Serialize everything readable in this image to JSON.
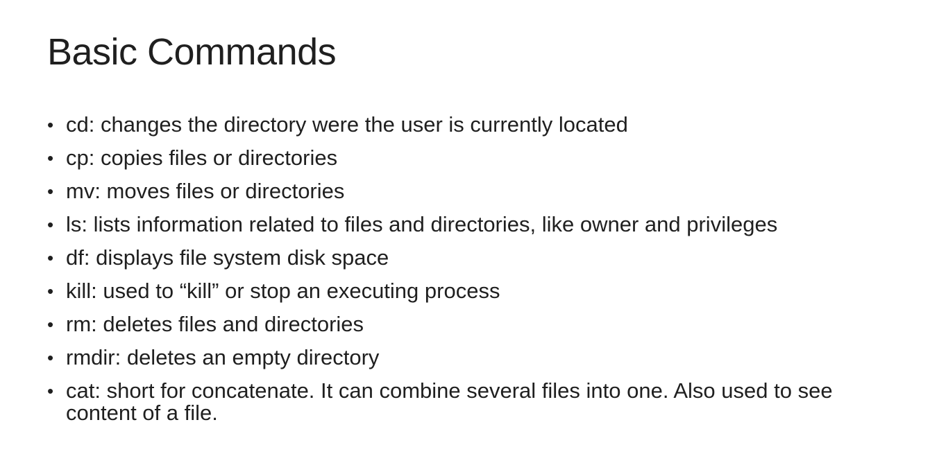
{
  "slide": {
    "title": "Basic Commands",
    "bullet_symbol": "•",
    "bullets": [
      "cd: changes the directory were the user is currently located",
      "cp: copies files or directories",
      "mv: moves files or directories",
      "ls: lists information related to files and directories, like owner and privileges",
      "df: displays file system disk space",
      "kill: used to “kill” or stop an executing process",
      "rm: deletes files and directories",
      "rmdir: deletes an empty directory",
      "cat: short for concatenate. It can combine several files into one. Also used to see content of a file."
    ]
  }
}
